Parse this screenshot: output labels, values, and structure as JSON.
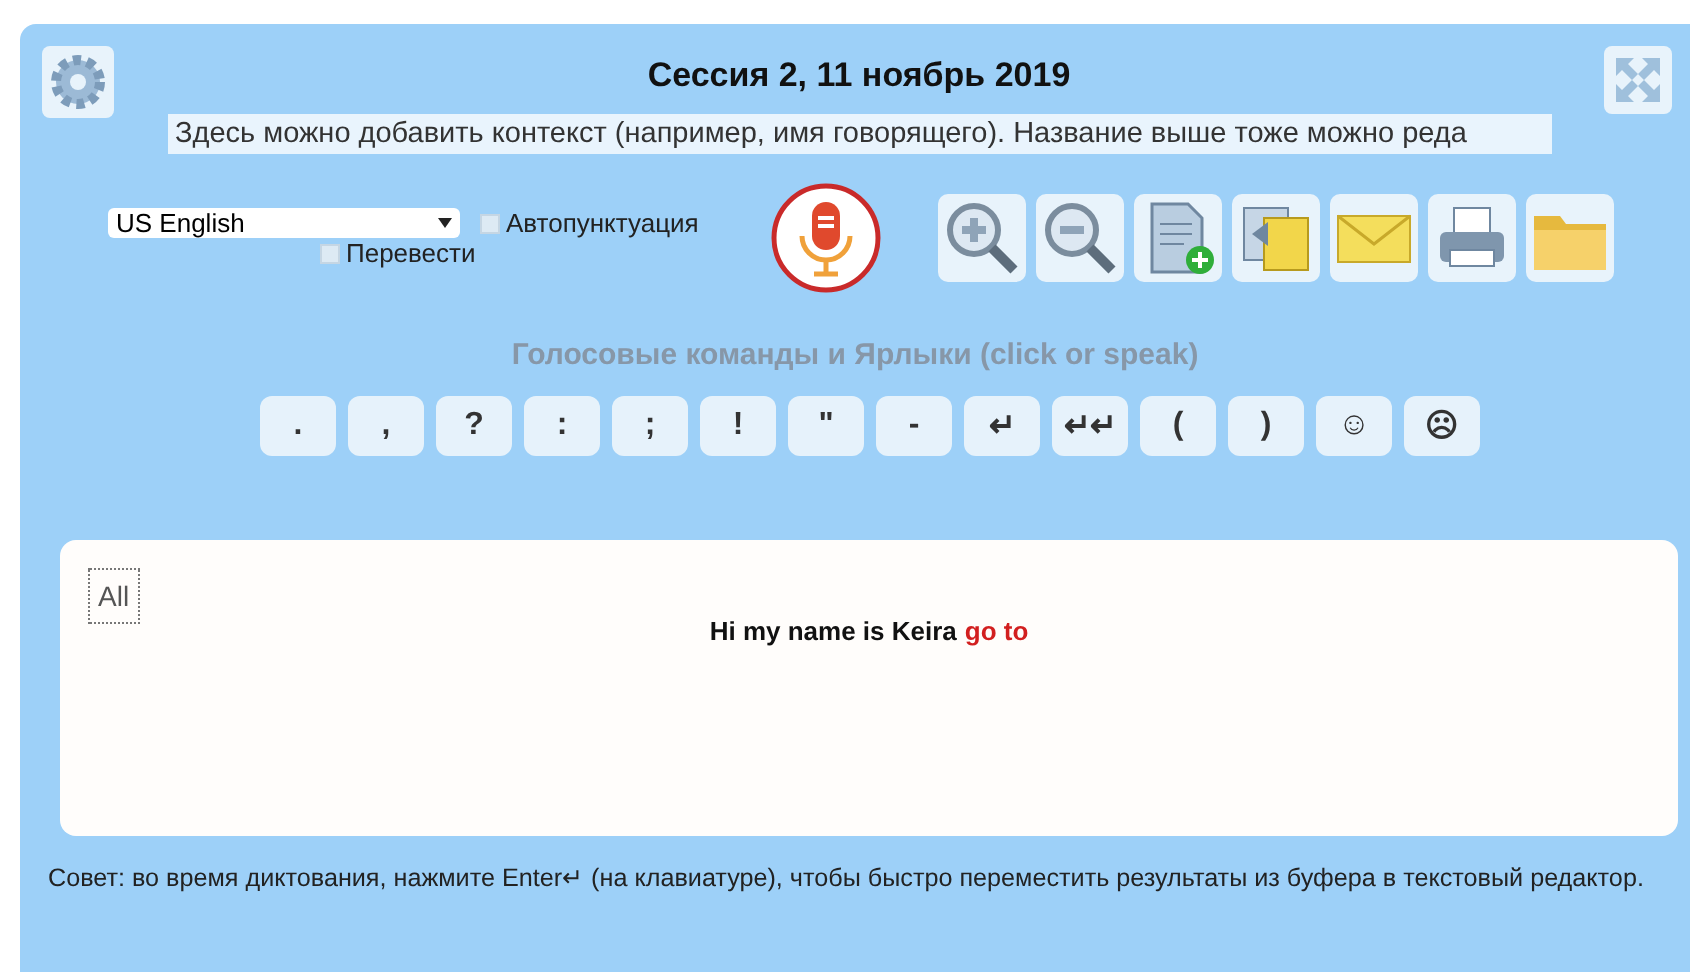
{
  "header": {
    "title": "Сессия 2, 11 ноябрь 2019",
    "context": "Здесь можно добавить контекст (например, имя говорящего). Название выше тоже можно реда"
  },
  "toolbar": {
    "language": "US English",
    "options": [
      {
        "label": "Автопунктуация",
        "checked": false
      },
      {
        "label": "Перевести",
        "checked": false
      }
    ],
    "recording": true
  },
  "commands": {
    "title": "Голосовые команды и Ярлыки (click or speak)",
    "keys": [
      ".",
      ",",
      "?",
      ":",
      ";",
      "!",
      "\"",
      "-",
      "↵",
      "↵↵",
      "(",
      ")",
      "☺",
      "☹"
    ]
  },
  "editor": {
    "select_all": "All",
    "final_text": "Hi my name is Keira",
    "interim_text": "go to"
  },
  "footer": "Совет: во время диктования, нажмите Enter↵ (на клавиатуре), чтобы быстро переместить результаты из буфера в текстовый редактор."
}
